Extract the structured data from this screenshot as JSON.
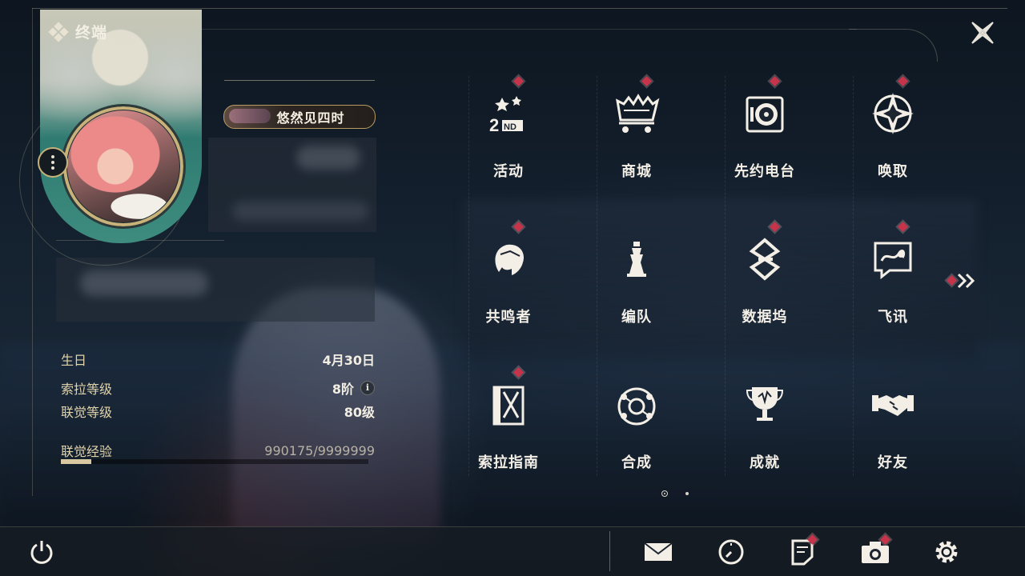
{
  "header": {
    "title": "终端"
  },
  "profile": {
    "name_plate": "悠然见四时"
  },
  "stats": {
    "birthday_label": "生日",
    "birthday_value": "4月30日",
    "sola_level_label": "索拉等级",
    "sola_level_value": "8阶",
    "info_glyph": "i",
    "union_level_label": "联觉等级",
    "union_level_value": "80级",
    "union_exp_label": "联觉经验",
    "union_exp_value": "990175/9999999",
    "union_exp_progress": 0.099
  },
  "menu": {
    "items": [
      {
        "label": "活动",
        "icon": "events-2nd-anniversary-icon",
        "badge": true
      },
      {
        "label": "商城",
        "icon": "shop-crown-cart-icon",
        "badge": true
      },
      {
        "label": "先约电台",
        "icon": "radio-icon",
        "badge": true
      },
      {
        "label": "唤取",
        "icon": "convene-star-icon",
        "badge": true
      },
      {
        "label": "共鸣者",
        "icon": "resonator-portrait-icon",
        "badge": true
      },
      {
        "label": "编队",
        "icon": "team-chess-icon",
        "badge": false
      },
      {
        "label": "数据坞",
        "icon": "data-bank-icon",
        "badge": true
      },
      {
        "label": "飞讯",
        "icon": "message-bubble-icon",
        "badge": true
      },
      {
        "label": "索拉指南",
        "icon": "sola-guide-icon",
        "badge": true
      },
      {
        "label": "合成",
        "icon": "synthesis-icon",
        "badge": false
      },
      {
        "label": "成就",
        "icon": "achievement-trophy-icon",
        "badge": false
      },
      {
        "label": "好友",
        "icon": "friends-handshake-icon",
        "badge": false
      }
    ],
    "pagination": {
      "current": 1,
      "total": 2
    }
  },
  "bottom_bar": {
    "items": [
      "power-icon",
      "mail-icon",
      "clock-icon",
      "notice-icon",
      "camera-icon",
      "settings-gear-icon"
    ]
  },
  "colors": {
    "accent_gold": "#c8b27a",
    "badge_red": "#c6334a",
    "label_gold": "#e1d3aa"
  }
}
